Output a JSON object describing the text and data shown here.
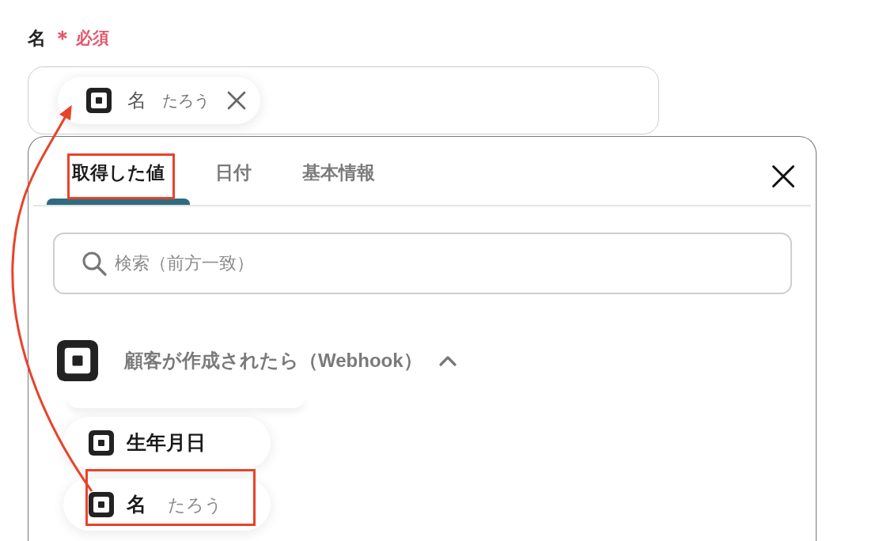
{
  "field": {
    "label": "名",
    "required_mark": "＊",
    "required_label": "必須",
    "token": {
      "label": "名",
      "value": "たろう"
    }
  },
  "panel": {
    "tabs": [
      {
        "label": "取得した値",
        "selected": true,
        "highlighted": true
      },
      {
        "label": "日付",
        "selected": false,
        "highlighted": false
      },
      {
        "label": "基本情報",
        "selected": false,
        "highlighted": false
      }
    ],
    "search": {
      "placeholder": "検索（前方一致）"
    },
    "group": {
      "title": "顧客が作成されたら（Webhook）",
      "expanded": true,
      "items": [
        {
          "label": "生年月日",
          "highlighted": false
        },
        {
          "label": "名",
          "value": "たろう",
          "highlighted": true
        }
      ]
    }
  }
}
